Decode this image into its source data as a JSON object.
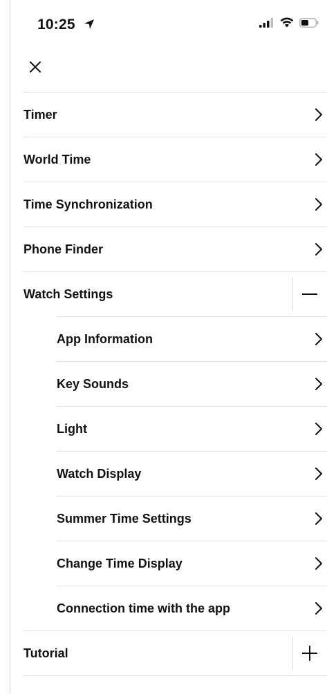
{
  "status_bar": {
    "time": "10:25",
    "location_icon": "location-arrow-icon",
    "signal_icon": "cellular-signal-icon",
    "wifi_icon": "wifi-icon",
    "battery_icon": "battery-icon"
  },
  "header": {
    "close_icon": "close-icon"
  },
  "menu": {
    "items": [
      {
        "label": "Timer"
      },
      {
        "label": "World Time"
      },
      {
        "label": "Time Synchronization"
      },
      {
        "label": "Phone Finder"
      },
      {
        "label": "Watch Settings",
        "expanded": true
      },
      {
        "label": "App Information",
        "child": true
      },
      {
        "label": "Key Sounds",
        "child": true
      },
      {
        "label": "Light",
        "child": true
      },
      {
        "label": "Watch Display",
        "child": true
      },
      {
        "label": "Summer Time Settings",
        "child": true
      },
      {
        "label": "Change Time Display",
        "child": true
      },
      {
        "label": "Connection time with the app",
        "child": true
      },
      {
        "label": "Tutorial",
        "expanded": false
      }
    ]
  },
  "colors": {
    "text": "#111111",
    "divider": "#e2e2e2",
    "background": "#ffffff"
  }
}
